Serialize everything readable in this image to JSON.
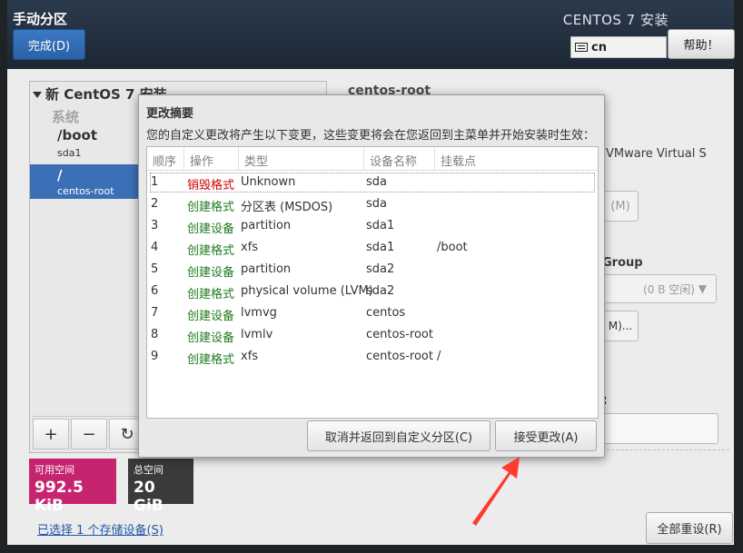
{
  "window": {
    "title": "手动分区",
    "done_button": "完成(D)",
    "product": "CENTOS 7 安装",
    "keyboard_layout": "cn",
    "help_button": "帮助！"
  },
  "tree": {
    "title": "新 CentOS 7 安装",
    "system_label": "系统",
    "entries": [
      {
        "name": "/boot",
        "device": "sda1"
      },
      {
        "name": "/",
        "device": "centos-root"
      }
    ],
    "add_button": "+",
    "remove_button": "−",
    "refresh_button": "↻"
  },
  "space": {
    "available_label": "可用空间",
    "available_value": "992.5 KiB",
    "available_color": "#c7246f",
    "total_label": "总空间",
    "total_value": "20 GiB",
    "total_color": "#3a3a3a"
  },
  "storage_link": "已选择 1 个存储设备(S)",
  "reset_button": "全部重设(R)",
  "background_right": {
    "heading": "centos-root",
    "device_text": "VMware Virtual S",
    "modify_button": "(M)",
    "vg_label": "Group",
    "vg_combo": "(0 B 空闲)",
    "vg_modify_button": "M)...",
    "colon_label": ":"
  },
  "dialog": {
    "title": "更改摘要",
    "description": "您的自定义更改将产生以下变更，这些变更将会在您返回到主菜单并开始安装时生效：",
    "columns": [
      "顺序",
      "操作",
      "类型",
      "设备名称",
      "挂载点"
    ],
    "rows": [
      {
        "order": "1",
        "action": "销毁格式",
        "kind": "destroy",
        "type": "Unknown",
        "device": "sda",
        "mount": ""
      },
      {
        "order": "2",
        "action": "创建格式",
        "kind": "create",
        "type": "分区表 (MSDOS)",
        "device": "sda",
        "mount": ""
      },
      {
        "order": "3",
        "action": "创建设备",
        "kind": "create",
        "type": "partition",
        "device": "sda1",
        "mount": ""
      },
      {
        "order": "4",
        "action": "创建格式",
        "kind": "create",
        "type": "xfs",
        "device": "sda1",
        "mount": "/boot"
      },
      {
        "order": "5",
        "action": "创建设备",
        "kind": "create",
        "type": "partition",
        "device": "sda2",
        "mount": ""
      },
      {
        "order": "6",
        "action": "创建格式",
        "kind": "create",
        "type": "physical volume (LVM)",
        "device": "sda2",
        "mount": ""
      },
      {
        "order": "7",
        "action": "创建设备",
        "kind": "create",
        "type": "lvmvg",
        "device": "centos",
        "mount": ""
      },
      {
        "order": "8",
        "action": "创建设备",
        "kind": "create",
        "type": "lvmlv",
        "device": "centos-root",
        "mount": ""
      },
      {
        "order": "9",
        "action": "创建格式",
        "kind": "create",
        "type": "xfs",
        "device": "centos-root",
        "mount": "/"
      }
    ],
    "cancel_button": "取消并返回到自定义分区(C)",
    "accept_button": "接受更改(A)"
  },
  "colors": {
    "destroy": "#d40000",
    "create": "#1e7b1e",
    "annotation_arrow": "#ff3b30"
  }
}
